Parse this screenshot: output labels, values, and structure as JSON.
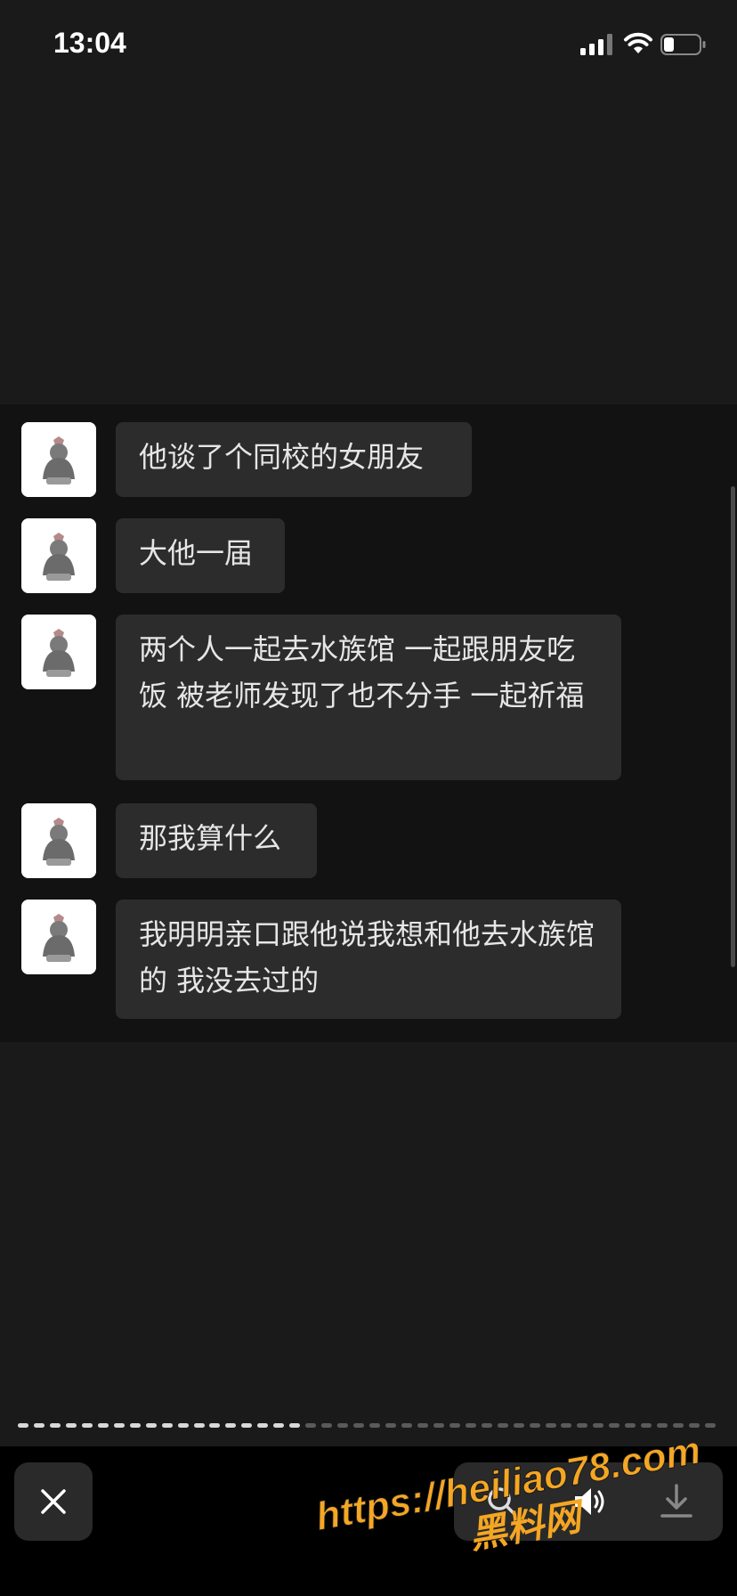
{
  "status_bar": {
    "time": "13:04"
  },
  "messages": [
    {
      "sender": "other",
      "text": "他谈了个同校的女朋友"
    },
    {
      "sender": "other",
      "text": "大他一届"
    },
    {
      "sender": "other",
      "text": "两个人一起去水族馆 一起跟朋友吃饭 被老师发现了也不分手 一起祈福"
    },
    {
      "sender": "other",
      "text": "那我算什么"
    },
    {
      "sender": "other",
      "text": "我明明亲口跟他说我想和他去水族馆的 我没去过的"
    }
  ],
  "viewer": {
    "progress_fraction": 0.42,
    "close_icon": "close-icon",
    "tools": [
      "search-icon",
      "speaker-icon",
      "download-icon"
    ]
  },
  "watermark": {
    "url": "https://heiliao78.com",
    "name": "黑料网"
  },
  "colors": {
    "background": "#1a1a1a",
    "panel": "#121212",
    "bubble": "#2c2c2c",
    "watermark": "#f5a623"
  }
}
